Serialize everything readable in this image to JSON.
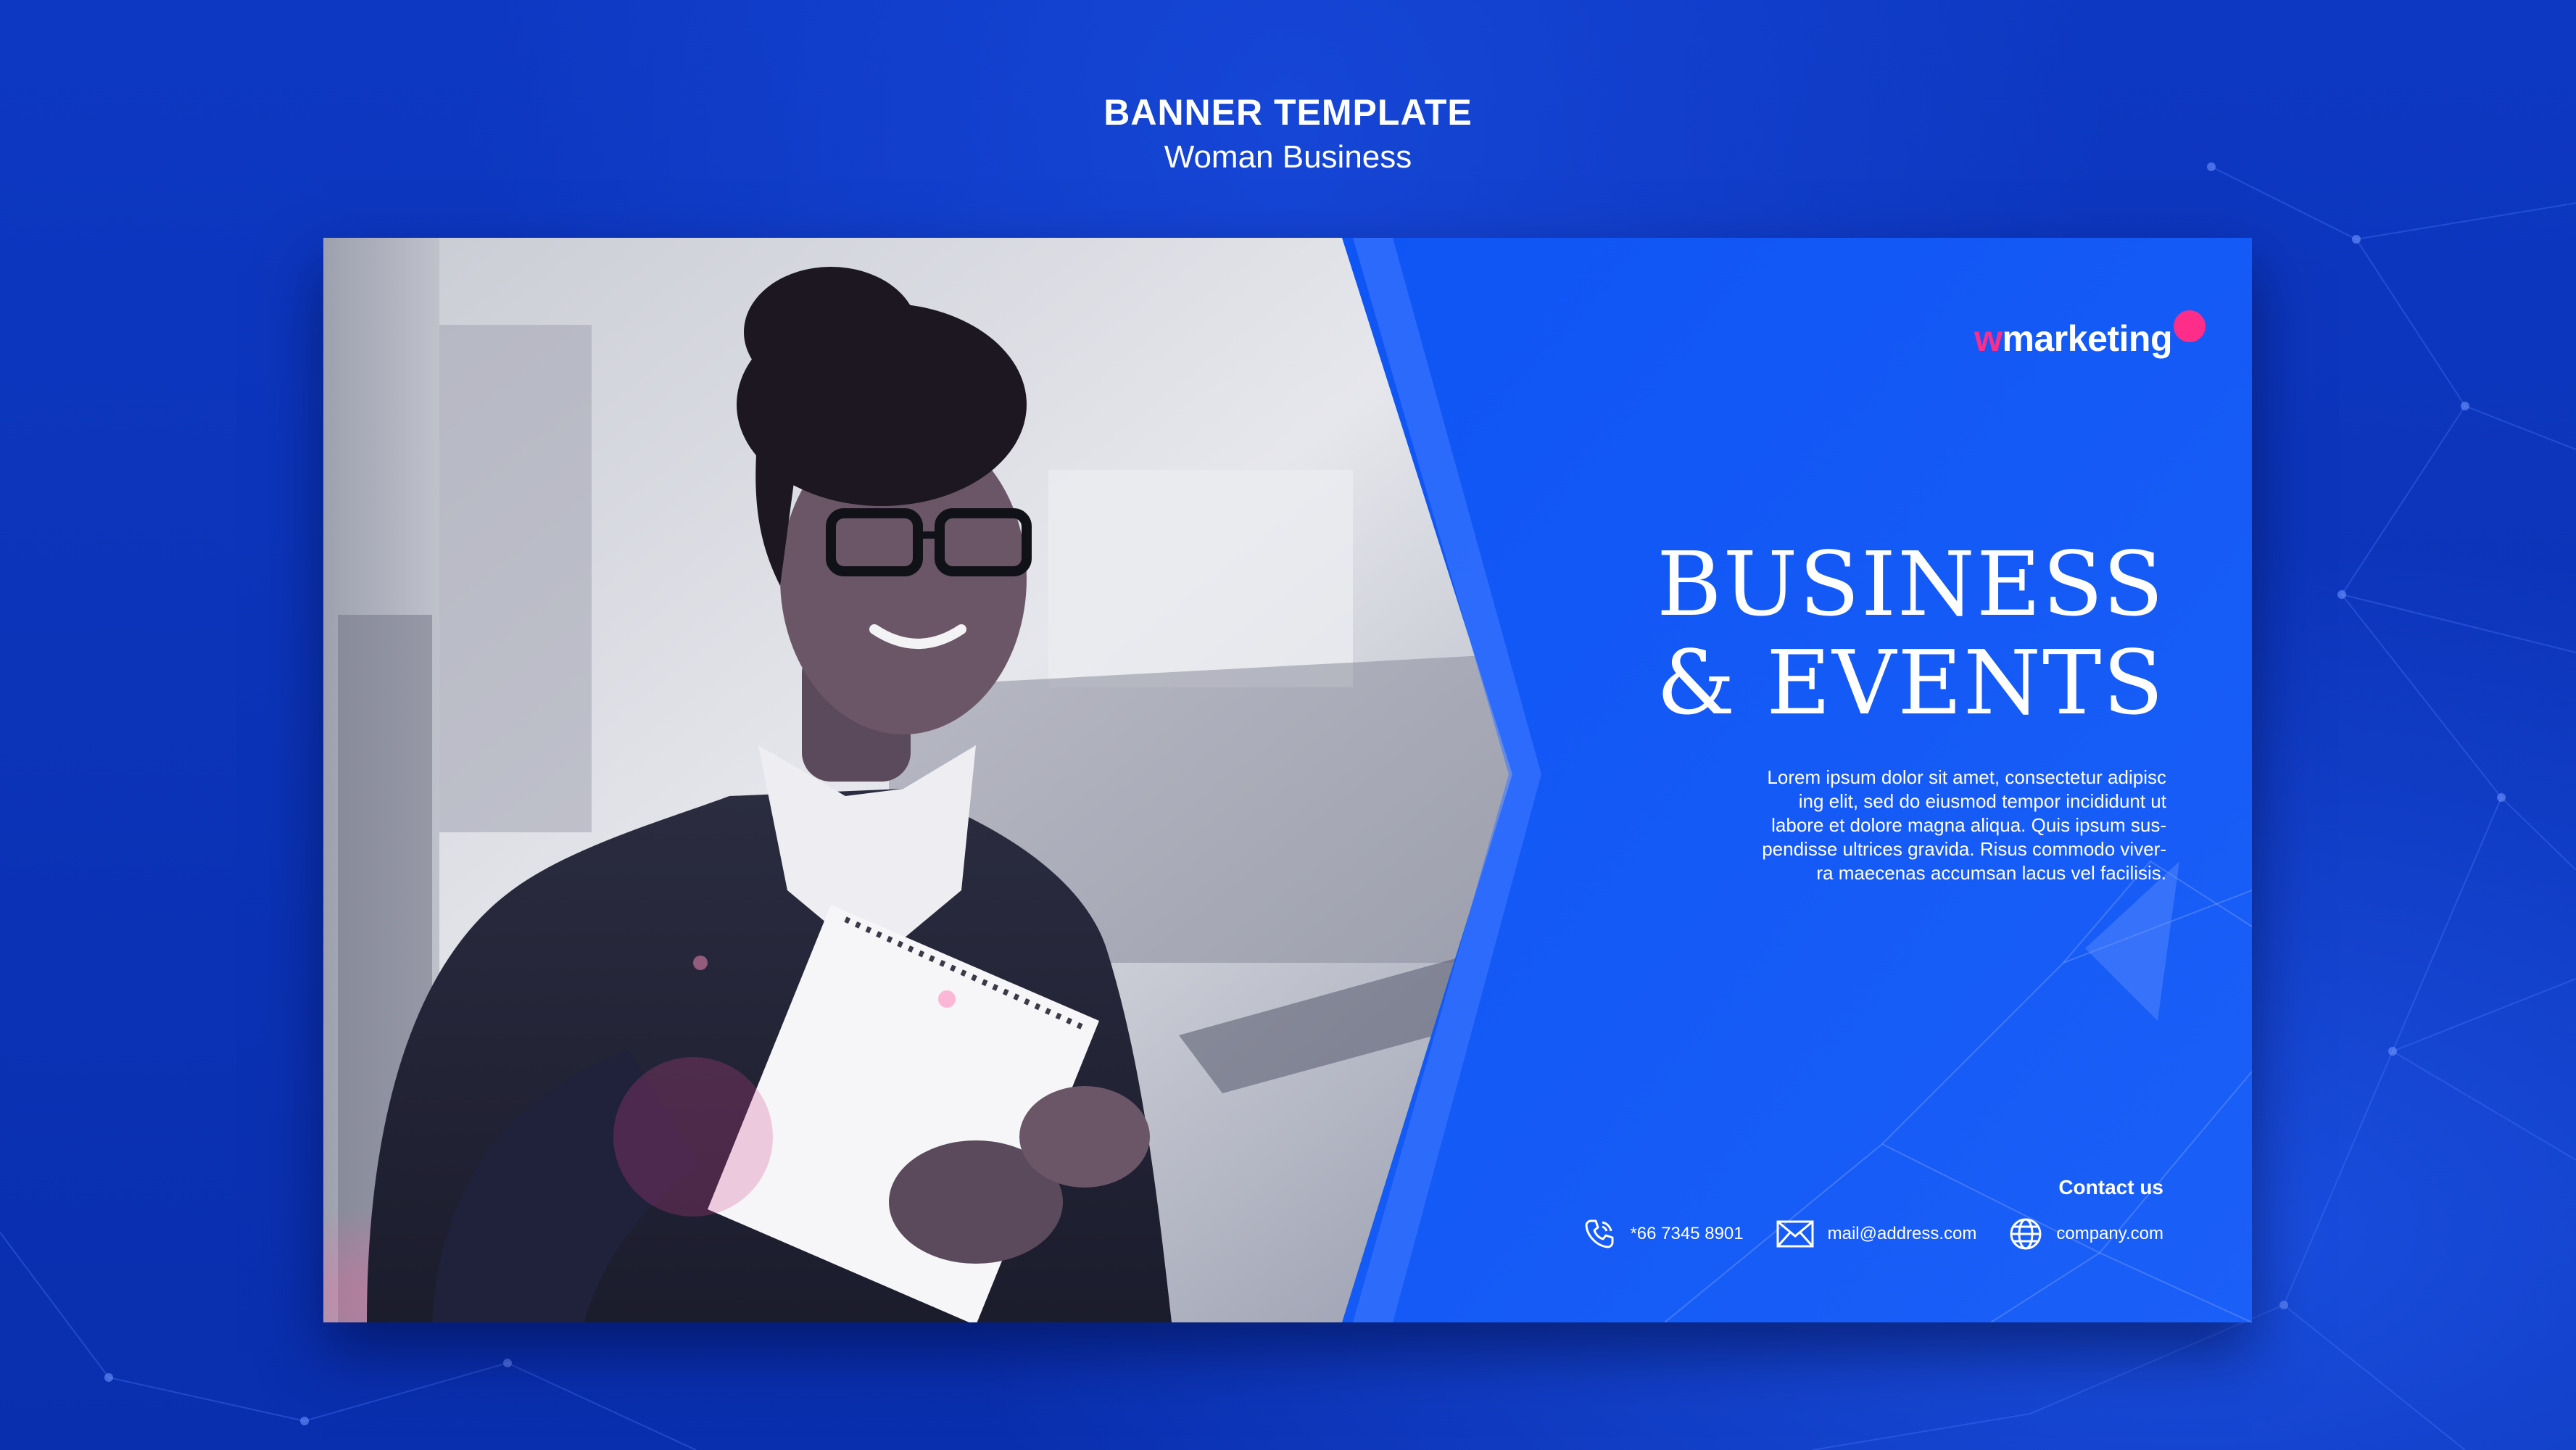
{
  "header": {
    "title": "BANNER TEMPLATE",
    "subtitle": "Woman Business"
  },
  "banner": {
    "logo": {
      "accent_letter": "w",
      "rest": "marketing"
    },
    "headline": {
      "line1": "BUSINESS",
      "line2": "& EVENTS"
    },
    "body_lines": [
      "Lorem ipsum dolor sit amet, consectetur adipisc",
      "ing elit, sed do eiusmod tempor incididunt ut",
      "labore et dolore magna aliqua. Quis ipsum sus-",
      "pendisse ultrices gravida. Risus commodo viver-",
      "ra maecenas accumsan lacus vel facilisis."
    ],
    "contact": {
      "label": "Contact us",
      "phone": "*66 7345 8901",
      "email": "mail@address.com",
      "website": "company.com"
    }
  },
  "icons": {
    "phone": "phone-icon",
    "email": "envelope-icon",
    "website": "globe-icon"
  },
  "colors": {
    "page_background": "#0b34b8",
    "banner_blue": "#1357f2",
    "logo_accent": "#ff2d8a",
    "text": "#ffffff"
  }
}
